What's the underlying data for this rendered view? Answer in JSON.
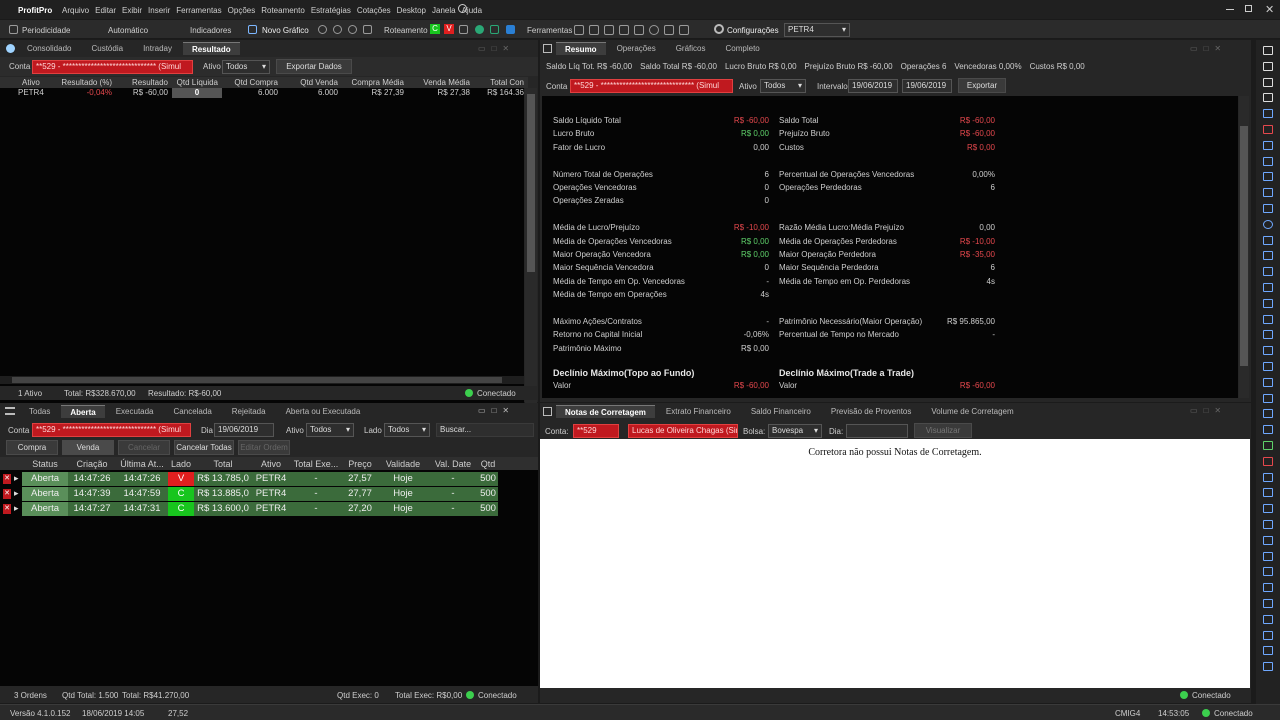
{
  "menubar": {
    "app": "ProfitPro",
    "items": [
      "Arquivo",
      "Editar",
      "Exibir",
      "Inserir",
      "Ferramentas",
      "Opções",
      "Roteamento",
      "Estratégias",
      "Cotações",
      "Desktop",
      "Janela",
      "Ajuda"
    ]
  },
  "toolbar": {
    "periodicidade": "Periodicidade",
    "automatico": "Automático",
    "indicadores": "Indicadores",
    "novo_grafico": "Novo Gráfico",
    "roteamento": "Roteamento",
    "ferramentas": "Ferramentas",
    "configuracoes": "Configurações",
    "ticker": "PETR4"
  },
  "pos": {
    "tabs": [
      "Consolidado",
      "Custódia",
      "Intraday",
      "Resultado"
    ],
    "active_tab": "Resultado",
    "conta_label": "Conta",
    "conta_value": "**529 - ****************************** (Simul",
    "ativo_label": "Ativo",
    "ativo_value": "Todos",
    "export_btn": "Exportar Dados",
    "columns": [
      "Ativo",
      "Resultado (%)",
      "Resultado",
      "Qtd Líquida",
      "Qtd Compra",
      "Qtd Venda",
      "Compra Média",
      "Venda Média",
      "Total Con"
    ],
    "row": [
      "PETR4",
      "-0,04%",
      "R$ -60,00",
      "0",
      "6.000",
      "6.000",
      "R$ 27,39",
      "R$ 27,38",
      "R$ 164.36"
    ],
    "status": {
      "ativos": "1 Ativo",
      "total": "Total: R$328.670,00",
      "resultado": "Resultado: R$-60,00",
      "conn": "Conectado"
    }
  },
  "res": {
    "tabs": [
      "Resumo",
      "Operações",
      "Gráficos",
      "Completo"
    ],
    "active_tab": "Resumo",
    "summary": [
      "Saldo Líq Tot. R$ -60,00",
      "Saldo Total R$ -60,00",
      "Lucro Bruto R$ 0,00",
      "Prejuízo Bruto R$ -60,00",
      "Operações 6",
      "Vencedoras 0,00%",
      "Custos R$ 0,00"
    ],
    "conta_label": "Conta",
    "conta_value": "**529 - ****************************** (Simul",
    "ativo_label": "Ativo",
    "ativo_value": "Todos",
    "intervalo_label": "Intervalo",
    "date_from": "19/06/2019",
    "date_to": "19/06/2019",
    "export_btn": "Exportar",
    "left_rows": [
      {
        "k": "Saldo Líquido Total",
        "v": "R$ -60,00",
        "c": "red"
      },
      {
        "k": "Lucro Bruto",
        "v": "R$ 0,00",
        "c": "green"
      },
      {
        "k": "Fator de Lucro",
        "v": "0,00",
        "c": ""
      },
      {
        "k": "",
        "v": "",
        "c": ""
      },
      {
        "k": "Número Total de Operações",
        "v": "6",
        "c": ""
      },
      {
        "k": "Operações Vencedoras",
        "v": "0",
        "c": ""
      },
      {
        "k": "Operações Zeradas",
        "v": "0",
        "c": ""
      },
      {
        "k": "",
        "v": "",
        "c": ""
      },
      {
        "k": "Média de Lucro/Prejuízo",
        "v": "R$ -10,00",
        "c": "red"
      },
      {
        "k": "Média de Operações Vencedoras",
        "v": "R$ 0,00",
        "c": "green"
      },
      {
        "k": "Maior Operação Vencedora",
        "v": "R$ 0,00",
        "c": "green"
      },
      {
        "k": "Maior Sequência Vencedora",
        "v": "0",
        "c": ""
      },
      {
        "k": "Média de Tempo em Op. Vencedoras",
        "v": "-",
        "c": ""
      },
      {
        "k": "Média de Tempo em Operações",
        "v": "4s",
        "c": ""
      },
      {
        "k": "",
        "v": "",
        "c": ""
      },
      {
        "k": "Máximo Ações/Contratos",
        "v": "-",
        "c": ""
      },
      {
        "k": "Retorno no Capital Inicial",
        "v": "-0,06%",
        "c": ""
      },
      {
        "k": "Patrimônio Máximo",
        "v": "R$ 0,00",
        "c": ""
      }
    ],
    "right_rows": [
      {
        "k": "Saldo Total",
        "v": "R$ -60,00",
        "c": "red"
      },
      {
        "k": "Prejuízo Bruto",
        "v": "R$ -60,00",
        "c": "red"
      },
      {
        "k": "Custos",
        "v": "R$ 0,00",
        "c": "red"
      },
      {
        "k": "",
        "v": "",
        "c": ""
      },
      {
        "k": "Percentual de Operações Vencedoras",
        "v": "0,00%",
        "c": ""
      },
      {
        "k": "Operações Perdedoras",
        "v": "6",
        "c": ""
      },
      {
        "k": "",
        "v": "",
        "c": ""
      },
      {
        "k": "",
        "v": "",
        "c": ""
      },
      {
        "k": "Razão Média Lucro:Média Prejuízo",
        "v": "0,00",
        "c": ""
      },
      {
        "k": "Média de Operações Perdedoras",
        "v": "R$ -10,00",
        "c": "red"
      },
      {
        "k": "Maior Operação Perdedora",
        "v": "R$ -35,00",
        "c": "red"
      },
      {
        "k": "Maior Sequência Perdedora",
        "v": "6",
        "c": ""
      },
      {
        "k": "Média de Tempo em Op. Perdedoras",
        "v": "4s",
        "c": ""
      },
      {
        "k": "",
        "v": "",
        "c": ""
      },
      {
        "k": "",
        "v": "",
        "c": ""
      },
      {
        "k": "Patrimônio Necessário(Maior Operação)",
        "v": "R$ 95.865,00",
        "c": ""
      },
      {
        "k": "Percentual de Tempo no Mercado",
        "v": "-",
        "c": ""
      },
      {
        "k": "",
        "v": "",
        "c": ""
      }
    ],
    "decl_left": {
      "title": "Declínio Máximo(Topo ao Fundo)",
      "k": "Valor",
      "v": "R$ -60,00"
    },
    "decl_right": {
      "title": "Declínio Máximo(Trade a Trade)",
      "k": "Valor",
      "v": "R$ -60,00"
    }
  },
  "ord": {
    "tabs": [
      "Todas",
      "Aberta",
      "Executada",
      "Cancelada",
      "Rejeitada",
      "Aberta ou Executada"
    ],
    "active_tab": "Aberta",
    "conta_label": "Conta",
    "conta_value": "**529 - ****************************** (Simul",
    "dia_label": "Dia",
    "dia_value": "19/06/2019",
    "ativo_label": "Ativo",
    "ativo_value": "Todos",
    "lado_label": "Lado",
    "lado_value": "Todos",
    "buscar": "Buscar...",
    "buttons": [
      "Compra",
      "Venda",
      "Cancelar",
      "Cancelar Todas",
      "Editar Ordem"
    ],
    "columns": [
      "Status",
      "Criação",
      "Última At...",
      "Lado",
      "Total",
      "Ativo",
      "Total Exe...",
      "Preço",
      "Validade",
      "Val. Date",
      "Qtd"
    ],
    "rows": [
      [
        "Aberta",
        "14:47:26",
        "14:47:26",
        "V",
        "R$ 13.785,0",
        "PETR4",
        "-",
        "27,57",
        "Hoje",
        "-",
        "500"
      ],
      [
        "Aberta",
        "14:47:39",
        "14:47:59",
        "C",
        "R$ 13.885,0",
        "PETR4",
        "-",
        "27,77",
        "Hoje",
        "-",
        "500"
      ],
      [
        "Aberta",
        "14:47:27",
        "14:47:31",
        "C",
        "R$ 13.600,0",
        "PETR4",
        "-",
        "27,20",
        "Hoje",
        "-",
        "500"
      ]
    ],
    "status": {
      "ordens": "3 Ordens",
      "qtd": "Qtd Total: 1.500",
      "total": "Total: R$41.270,00",
      "exec": "Qtd Exec: 0",
      "total_exec": "Total Exec: R$0,00",
      "conn": "Conectado"
    }
  },
  "notas": {
    "tabs": [
      "Notas de Corretagem",
      "Extrato Financeiro",
      "Saldo Financeiro",
      "Previsão de Proventos",
      "Volume de Corretagem"
    ],
    "active_tab": "Notas de Corretagem",
    "conta_label": "Conta:",
    "conta_value": "**529",
    "name_value": "Lucas de Oliveira Chagas (Sim",
    "bolsa_label": "Bolsa:",
    "bolsa_value": "Bovespa",
    "dia_label": "Dia:",
    "visualizar": "Visualizar",
    "message": "Corretora não possui Notas de Corretagem.",
    "conn": "Conectado"
  },
  "statusbar": {
    "version": "Versão 4.1.0.152",
    "date": "18/06/2019 14:05",
    "price": "27,52",
    "ticker": "CMIG4",
    "time": "14:53:05",
    "conn": "Conectado"
  },
  "colors": {
    "accent_red": "#c0191f",
    "green": "#5fd16a",
    "red": "#e5484d",
    "row_green": "#3b6b3b",
    "sell": "#e01f1f",
    "buy": "#18c51e"
  }
}
